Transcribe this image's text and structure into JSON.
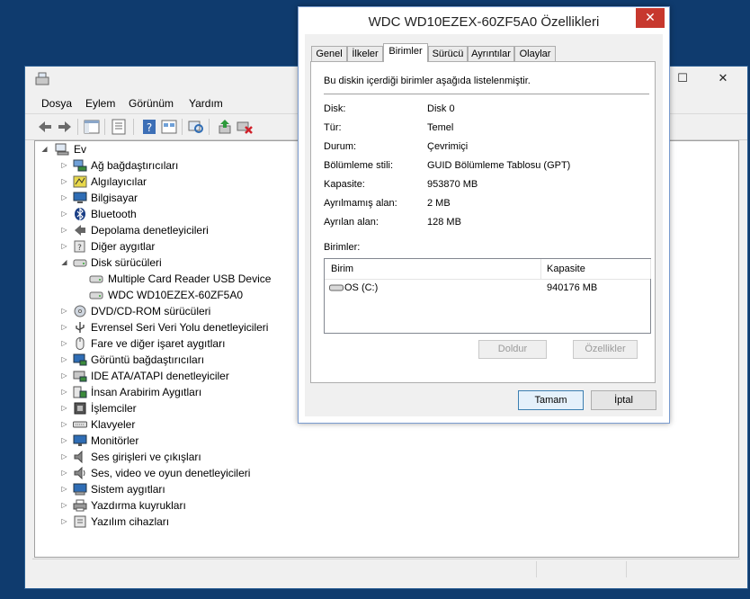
{
  "device_manager": {
    "window_controls": {
      "maximize": "☐",
      "close": "✕"
    },
    "menu": [
      "Dosya",
      "Eylem",
      "Görünüm",
      "Yardım"
    ],
    "toolbar_icons": [
      "back-arrow-icon",
      "forward-arrow-icon",
      "show-hide-tree-icon",
      "properties-icon",
      "help-icon",
      "view-icon",
      "scan-hardware-icon",
      "update-driver-icon",
      "uninstall-icon"
    ],
    "tree": {
      "root": "Ev",
      "categories": [
        {
          "label": "Ağ bağdaştırıcıları",
          "icon": "network-adapter-icon",
          "expanded": false
        },
        {
          "label": "Algılayıcılar",
          "icon": "sensor-icon",
          "expanded": false
        },
        {
          "label": "Bilgisayar",
          "icon": "computer-icon",
          "expanded": false
        },
        {
          "label": "Bluetooth",
          "icon": "bluetooth-icon",
          "expanded": false
        },
        {
          "label": "Depolama denetleyicileri",
          "icon": "storage-controller-icon",
          "expanded": false
        },
        {
          "label": "Diğer aygıtlar",
          "icon": "other-devices-icon",
          "expanded": false
        },
        {
          "label": "Disk sürücüleri",
          "icon": "disk-drive-icon",
          "expanded": true,
          "children": [
            "Multiple Card  Reader USB Device",
            "WDC WD10EZEX-60ZF5A0"
          ]
        },
        {
          "label": "DVD/CD-ROM sürücüleri",
          "icon": "dvd-drive-icon",
          "expanded": false
        },
        {
          "label": "Evrensel Seri Veri Yolu denetleyicileri",
          "icon": "usb-icon",
          "expanded": false
        },
        {
          "label": "Fare ve diğer işaret aygıtları",
          "icon": "mouse-icon",
          "expanded": false
        },
        {
          "label": "Görüntü bağdaştırıcıları",
          "icon": "display-adapter-icon",
          "expanded": false
        },
        {
          "label": "IDE ATA/ATAPI denetleyiciler",
          "icon": "ide-controller-icon",
          "expanded": false
        },
        {
          "label": "İnsan Arabirim Aygıtları",
          "icon": "hid-icon",
          "expanded": false
        },
        {
          "label": "İşlemciler",
          "icon": "processor-icon",
          "expanded": false
        },
        {
          "label": "Klavyeler",
          "icon": "keyboard-icon",
          "expanded": false
        },
        {
          "label": "Monitörler",
          "icon": "monitor-icon",
          "expanded": false
        },
        {
          "label": "Ses girişleri ve çıkışları",
          "icon": "speaker-icon",
          "expanded": false
        },
        {
          "label": "Ses, video ve oyun denetleyicileri",
          "icon": "audio-icon",
          "expanded": false
        },
        {
          "label": "Sistem aygıtları",
          "icon": "system-devices-icon",
          "expanded": false
        },
        {
          "label": "Yazdırma kuyrukları",
          "icon": "printer-icon",
          "expanded": false
        },
        {
          "label": "Yazılım cihazları",
          "icon": "software-device-icon",
          "expanded": false
        }
      ]
    }
  },
  "dialog": {
    "title": "WDC WD10EZEX-60ZF5A0 Özellikleri",
    "close_glyph": "✕",
    "tabs": [
      "Genel",
      "İlkeler",
      "Birimler",
      "Sürücü",
      "Ayrıntılar",
      "Olaylar"
    ],
    "active_tab": "Birimler",
    "description": "Bu diskin içerdiği birimler aşağıda listelenmiştir.",
    "properties": [
      {
        "label": "Disk:",
        "value": "Disk 0"
      },
      {
        "label": "Tür:",
        "value": "Temel"
      },
      {
        "label": "Durum:",
        "value": "Çevrimiçi"
      },
      {
        "label": "Bölümleme stili:",
        "value": "GUID Bölümleme Tablosu (GPT)"
      },
      {
        "label": "Kapasite:",
        "value": "953870 MB"
      },
      {
        "label": "Ayrılmamış alan:",
        "value": "2 MB"
      },
      {
        "label": "Ayrılan alan:",
        "value": "128 MB"
      }
    ],
    "volumes_label": "Birimler:",
    "volumes_table": {
      "columns": [
        "Birim",
        "Kapasite"
      ],
      "rows": [
        {
          "volume": "OS (C:)",
          "capacity": "940176 MB"
        }
      ]
    },
    "buttons": {
      "populate": "Doldur",
      "properties": "Özellikler",
      "ok": "Tamam",
      "cancel": "İptal"
    }
  }
}
